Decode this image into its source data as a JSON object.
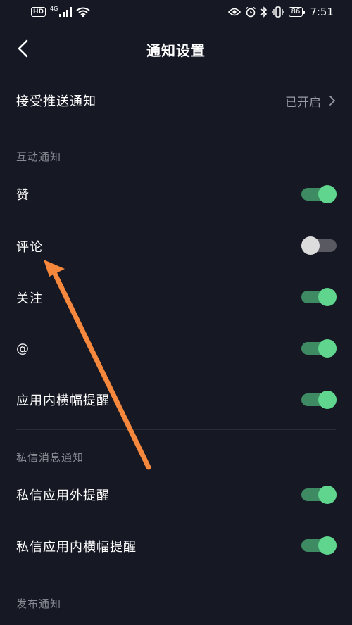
{
  "status_bar": {
    "hd": "HD",
    "network": "4G",
    "battery": "86",
    "time": "7:51"
  },
  "header": {
    "title": "通知设置"
  },
  "push": {
    "label": "接受推送通知",
    "value": "已开启"
  },
  "interaction": {
    "section_title": "互动通知",
    "items": [
      {
        "label": "赞",
        "enabled": true
      },
      {
        "label": "评论",
        "enabled": false
      },
      {
        "label": "关注",
        "enabled": true
      },
      {
        "label": "@",
        "enabled": true
      },
      {
        "label": "应用内横幅提醒",
        "enabled": true
      }
    ]
  },
  "messages": {
    "section_title": "私信消息通知",
    "items": [
      {
        "label": "私信应用外提醒",
        "enabled": true
      },
      {
        "label": "私信应用内横幅提醒",
        "enabled": true
      }
    ]
  },
  "publish": {
    "section_title": "发布通知"
  },
  "colors": {
    "background": "#161823",
    "toggle_on_track": "#3e8a63",
    "toggle_on_knob": "#5fd58d",
    "toggle_off_track": "#595a61",
    "toggle_off_knob": "#dcdcdc",
    "annotation_arrow": "#f5883c"
  }
}
